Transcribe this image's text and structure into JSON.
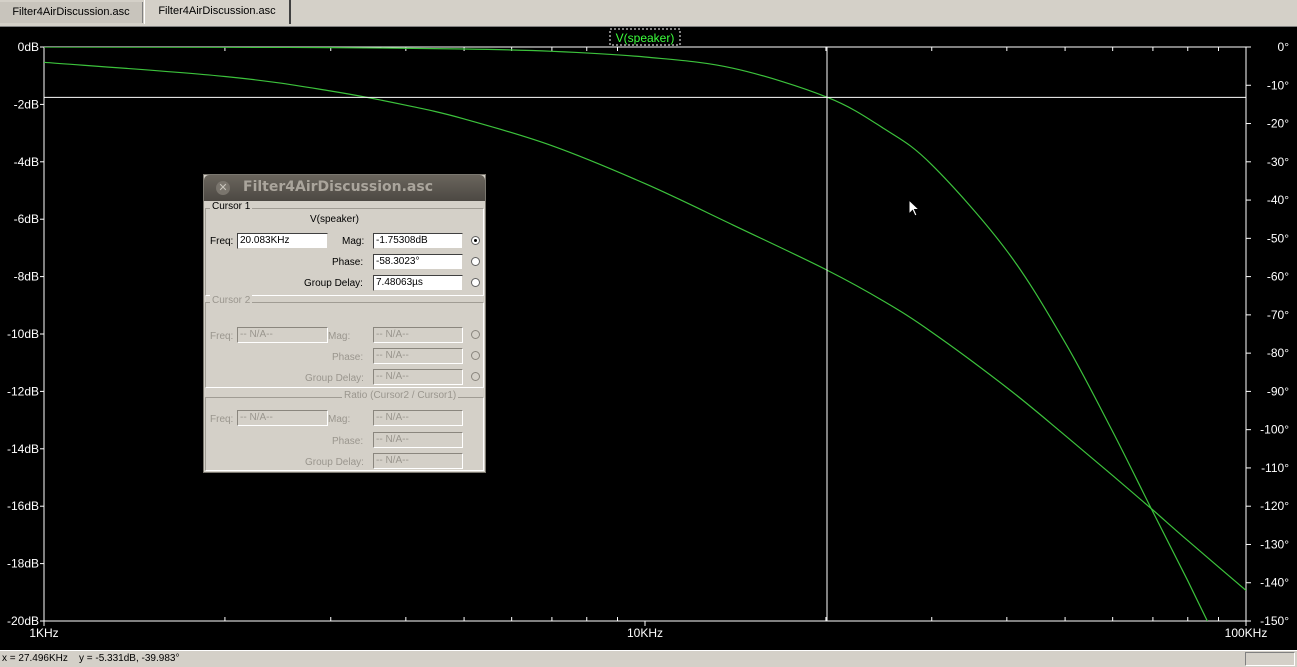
{
  "tabs": [
    {
      "label": "Filter4AirDiscussion.asc",
      "active": false
    },
    {
      "label": "Filter4AirDiscussion.asc",
      "active": true
    }
  ],
  "plot": {
    "trace_label": "V(speaker)",
    "background": "#000000",
    "trace_color": "#3cc23c",
    "label_color": "#3cff3c",
    "axis_color": "#ffffff"
  },
  "chart_data": {
    "type": "line",
    "xscale": "log",
    "xlim": [
      1000,
      100000
    ],
    "x_tick_labels": [
      "1KHz",
      "10KHz",
      "100KHz"
    ],
    "y_left_ticks": [
      "0dB",
      "-2dB",
      "-4dB",
      "-6dB",
      "-8dB",
      "-10dB",
      "-12dB",
      "-14dB",
      "-16dB",
      "-18dB",
      "-20dB"
    ],
    "y_left_range": [
      -20,
      0
    ],
    "y_right_ticks": [
      "0°",
      "-10°",
      "-20°",
      "-30°",
      "-40°",
      "-50°",
      "-60°",
      "-70°",
      "-80°",
      "-90°",
      "-100°",
      "-110°",
      "-120°",
      "-130°",
      "-140°",
      "-150°"
    ],
    "y_right_range": [
      -150,
      0
    ],
    "series": [
      {
        "name": "magnitude",
        "unit": "dB",
        "x": [
          1000,
          2000,
          3000,
          5000,
          7000,
          10000,
          14000,
          20083,
          25000,
          30000,
          40000,
          50000,
          60000,
          70000,
          80000,
          90000,
          100000
        ],
        "y": [
          0,
          -0.01,
          -0.02,
          -0.07,
          -0.15,
          -0.35,
          -0.74,
          -1.75,
          -2.85,
          -4.1,
          -7.1,
          -10.3,
          -13.4,
          -16.2,
          -18.6,
          -20.8,
          -22.7
        ]
      },
      {
        "name": "phase",
        "unit": "°",
        "x": [
          1000,
          2000,
          3000,
          4000,
          5000,
          7000,
          10000,
          14000,
          20083,
          25000,
          30000,
          40000,
          50000,
          60000,
          70000,
          80000,
          100000
        ],
        "y": [
          -4,
          -7.7,
          -11.5,
          -15.2,
          -18.8,
          -25.8,
          -35.7,
          -46.5,
          -58.3,
          -66.5,
          -74.5,
          -89,
          -101.5,
          -112,
          -121,
          -129,
          -142
        ]
      }
    ],
    "cursor": {
      "freq": 20083,
      "mag_db": -1.75308,
      "phase_deg": -58.3023
    }
  },
  "status": {
    "text": "x = 27.496KHz    y = -5.331dB, -39.983°"
  },
  "dialog": {
    "title": "Filter4AirDiscussion.asc",
    "cursor1": {
      "group_label": "Cursor 1",
      "trace": "V(speaker)",
      "freq_label": "Freq:",
      "freq": "20.083KHz",
      "mag_label": "Mag:",
      "mag": "-1.75308dB",
      "phase_label": "Phase:",
      "phase": "-58.3023°",
      "gd_label": "Group Delay:",
      "group_delay": "7.48063µs"
    },
    "cursor2": {
      "group_label": "Cursor 2",
      "freq_label": "Freq:",
      "freq": "-- N/A--",
      "mag_label": "Mag:",
      "mag": "-- N/A--",
      "phase_label": "Phase:",
      "phase": "-- N/A--",
      "gd_label": "Group Delay:",
      "group_delay": "-- N/A--"
    },
    "ratio": {
      "group_label": "Ratio (Cursor2 / Cursor1)",
      "freq_label": "Freq:",
      "freq": "-- N/A--",
      "mag_label": "Mag:",
      "mag": "-- N/A--",
      "phase_label": "Phase:",
      "phase": "-- N/A--",
      "gd_label": "Group Delay:",
      "group_delay": "-- N/A--"
    }
  }
}
